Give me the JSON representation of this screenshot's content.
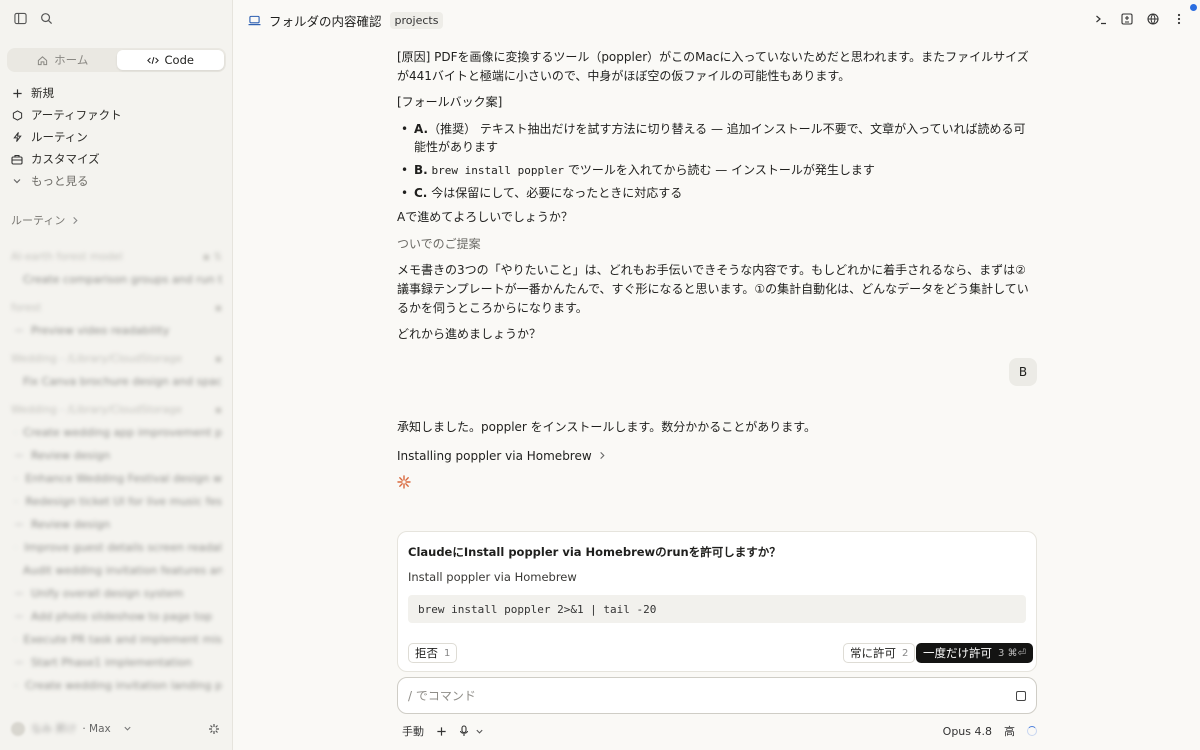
{
  "sidebar": {
    "segments": [
      {
        "label": "ホーム"
      },
      {
        "label": "Code"
      }
    ],
    "nav": [
      {
        "label": "新規"
      },
      {
        "label": "アーティファクト"
      },
      {
        "label": "ルーティン"
      },
      {
        "label": "カスタマイズ"
      },
      {
        "label": "もっと見る"
      }
    ],
    "section_title": "ルーティン",
    "sessions": [
      {
        "group": "AI-earth forest model"
      },
      {
        "item": "Create comparison groups and run t"
      },
      {
        "group": "forest"
      },
      {
        "item": "Preview video readability"
      },
      {
        "group": "Wedding - /Library/CloudStorage"
      },
      {
        "item": "Fix Canva brochure design and spac"
      },
      {
        "group": "Wedding - /Library/CloudStorage"
      },
      {
        "item": "Create wedding app improvement p"
      },
      {
        "item": "Review design"
      },
      {
        "item": "Enhance Wedding Festival design w"
      },
      {
        "item": "Redesign ticket UI for live music fes"
      },
      {
        "item": "Review design"
      },
      {
        "item": "Improve guest details screen readal"
      },
      {
        "item": "Audit wedding invitation features an"
      },
      {
        "item": "Unify overall design system"
      },
      {
        "item": "Add photo slideshow to page top"
      },
      {
        "item": "Execute PR task and implement mis"
      },
      {
        "item": "Start Phase1 implementation"
      },
      {
        "item": "Create wedding invitation landing p"
      }
    ],
    "user": {
      "name": "なみ 昇け",
      "plan": "· Max"
    }
  },
  "header": {
    "title": "フォルダの内容確認",
    "chip": "projects"
  },
  "messages": {
    "cause": "[原因] PDFを画像に変換するツール（poppler）がこのMacに入っていないためだと思われます。またファイルサイズが441バイトと極端に小さいので、中身がほぼ空の仮ファイルの可能性もあります。",
    "fallback_title": "[フォールバック案]",
    "opt_a_key": "A.",
    "opt_a_text": "（推奨） テキスト抽出だけを試す方法に切り替える — 追加インストール不要で、文章が入っていれば読める可能性があります",
    "opt_b_key": "B.",
    "opt_b_code": "brew install poppler",
    "opt_b_text": " でツールを入れてから読む — インストールが発生します",
    "opt_c_key": "C.",
    "opt_c_text": "今は保留にして、必要になったときに対応する",
    "question": "Aで進めてよろしいでしょうか？",
    "aside": "ついでのご提案",
    "proposal": "メモ書きの3つの「やりたいこと」は、どれもお手伝いできそうな内容です。もしどれかに着手されるなら、まずは②議事録テンプレートが一番かんたんで、すぐ形になると思います。①の集計自動化は、どんなデータをどう集計しているかを伺うところからになります。",
    "which": "どれから進めましょうか？",
    "user_reply": "B",
    "ack": "承知しました。poppler をインストールします。数分かかることがあります。",
    "tool_link": "Installing poppler via Homebrew"
  },
  "permission": {
    "title": "ClaudeにInstall poppler via Homebrewのrunを許可しますか？",
    "description": "Install poppler via Homebrew",
    "command": "brew install poppler 2>&1 | tail -20",
    "deny_label": "拒否",
    "deny_key": "1",
    "always_label": "常に許可",
    "always_key": "2",
    "once_label": "一度だけ許可",
    "once_key": "3 ⌘⏎"
  },
  "composer": {
    "placeholder": "/ でコマンド",
    "mode": "手動",
    "model": "Opus 4.8",
    "effort": "高"
  }
}
